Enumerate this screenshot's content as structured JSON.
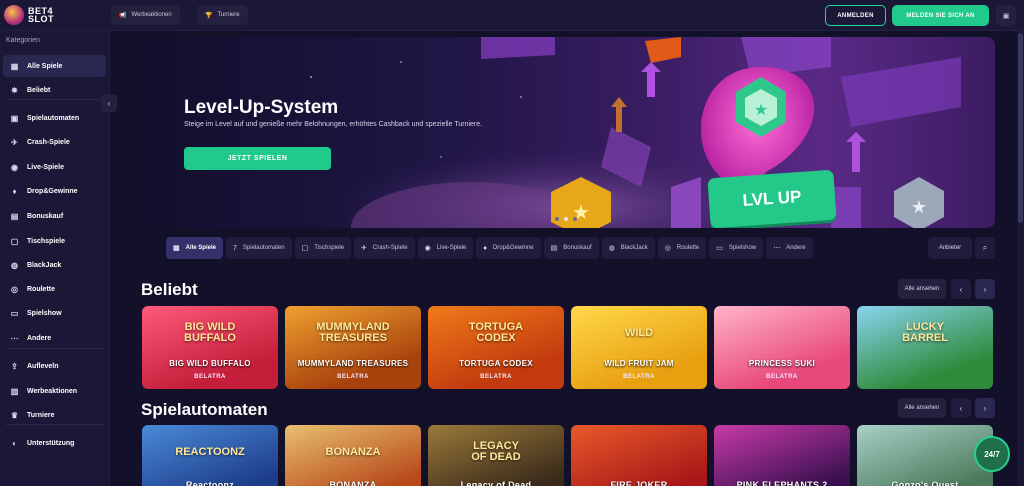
{
  "topbar": {
    "logo_text": "BET4\nSLOT",
    "promotions": "Werbeaktionen",
    "tournaments": "Turniere",
    "login": "ANMELDEN",
    "register": "MELDEN SIE SICH AN"
  },
  "sidebar": {
    "heading": "Kategorien",
    "items": [
      {
        "label": "Alle Spiele",
        "icon": "grid-icon",
        "glyph": "▦"
      },
      {
        "label": "Beliebt",
        "icon": "star-icon",
        "glyph": "✸"
      },
      {
        "label": "Spielautomaten",
        "icon": "slot-icon",
        "glyph": "▣"
      },
      {
        "label": "Crash-Spiele",
        "icon": "plane-icon",
        "glyph": "✈"
      },
      {
        "label": "Live-Spiele",
        "icon": "live-icon",
        "glyph": "◉"
      },
      {
        "label": "Drop&Gewinne",
        "icon": "drop-icon",
        "glyph": "♦"
      },
      {
        "label": "Bonuskauf",
        "icon": "gift-icon",
        "glyph": "▤"
      },
      {
        "label": "Tischspiele",
        "icon": "table-icon",
        "glyph": "▢"
      },
      {
        "label": "BlackJack",
        "icon": "cards-icon",
        "glyph": "◍"
      },
      {
        "label": "Roulette",
        "icon": "roulette-icon",
        "glyph": "◎"
      },
      {
        "label": "Spielshow",
        "icon": "show-icon",
        "glyph": "▭"
      },
      {
        "label": "Andere",
        "icon": "more-icon",
        "glyph": "⋯"
      },
      {
        "label": "Aufleveln",
        "icon": "levelup-icon",
        "glyph": "⇪"
      },
      {
        "label": "Werbeaktionen",
        "icon": "promo-icon",
        "glyph": "▥"
      },
      {
        "label": "Turniere",
        "icon": "trophy-icon",
        "glyph": "♛"
      },
      {
        "label": "Unterstützung",
        "icon": "support-icon",
        "glyph": "◐"
      }
    ]
  },
  "banner": {
    "title": "Level-Up-System",
    "subtitle": "Steige im Level auf und genieße mehr Belohnungen, erhöhtes Cashback und spezielle Turniere.",
    "cta": "JETZT SPIELEN",
    "badge": "LVL UP"
  },
  "filters": [
    {
      "label": "Alle Spiele",
      "glyph": "▦"
    },
    {
      "label": "Spielautomaten",
      "glyph": "7"
    },
    {
      "label": "Tischspiele",
      "glyph": "▢"
    },
    {
      "label": "Crash-Spiele",
      "glyph": "✈"
    },
    {
      "label": "Live-Spiele",
      "glyph": "◉"
    },
    {
      "label": "Drop&Gewinne",
      "glyph": "♦"
    },
    {
      "label": "Bonuskauf",
      "glyph": "▤"
    },
    {
      "label": "BlackJack",
      "glyph": "◍"
    },
    {
      "label": "Roulette",
      "glyph": "◎"
    },
    {
      "label": "Spielshow",
      "glyph": "▭"
    },
    {
      "label": "Andere",
      "glyph": "⋯"
    }
  ],
  "providers_button": "Anbieter",
  "sections": [
    {
      "title": "Beliebt",
      "view_all": "Alle ansehen",
      "games": [
        {
          "title": "BIG WILD BUFFALO",
          "logo": "BIG WILD\nBUFFALO",
          "provider": "BELATRA",
          "bg": "#c41e3a",
          "bg2": "#ff5a7a"
        },
        {
          "title": "MUMMYLAND TREASURES",
          "logo": "MUMMYLAND\nTREASURES",
          "provider": "BELATRA",
          "bg": "#a8420d",
          "bg2": "#f0a030"
        },
        {
          "title": "TORTUGA CODEX",
          "logo": "TORTUGA\nCODEX",
          "provider": "BELATRA",
          "bg": "#c23a0e",
          "bg2": "#f07a1a"
        },
        {
          "title": "WILD FRUIT JAM",
          "logo": "WILD",
          "provider": "BELATRA",
          "bg": "#e8a010",
          "bg2": "#ffd84a"
        },
        {
          "title": "PRINCESS SUKI",
          "logo": "",
          "provider": "BELATRA",
          "bg": "#e8487a",
          "bg2": "#ffb3c8"
        },
        {
          "title": "",
          "logo": "LUCKY\nBARREL",
          "provider": "",
          "bg": "#2f8a3a",
          "bg2": "#8ad4f0"
        }
      ]
    },
    {
      "title": "Spielautomaten",
      "view_all": "Alle ansehen",
      "games": [
        {
          "title": "Reactoonz",
          "logo": "REACTOONZ",
          "bg": "#1d3d8a",
          "bg2": "#4a8ad8"
        },
        {
          "title": "BONANZA",
          "logo": "BONANZA",
          "bg": "#b84a1a",
          "bg2": "#e8c070"
        },
        {
          "title": "Legacy of Dead",
          "logo": "LEGACY\nOF DEAD",
          "bg": "#3a2a1a",
          "bg2": "#9a7a3a"
        },
        {
          "title": "FIRE JOKER",
          "logo": "",
          "bg": "#a81818",
          "bg2": "#e85a2a"
        },
        {
          "title": "PINK ELEPHANTS 2",
          "logo": "",
          "bg": "#3a1050",
          "bg2": "#c83aa8"
        },
        {
          "title": "Gonzo's Quest",
          "logo": "",
          "bg": "#4a7a5a",
          "bg2": "#a8d0c8"
        }
      ]
    }
  ],
  "chat_badge": "24/7",
  "colors": {
    "accent": "#21c98d",
    "background": "#13112a",
    "panel": "#1a1836"
  }
}
